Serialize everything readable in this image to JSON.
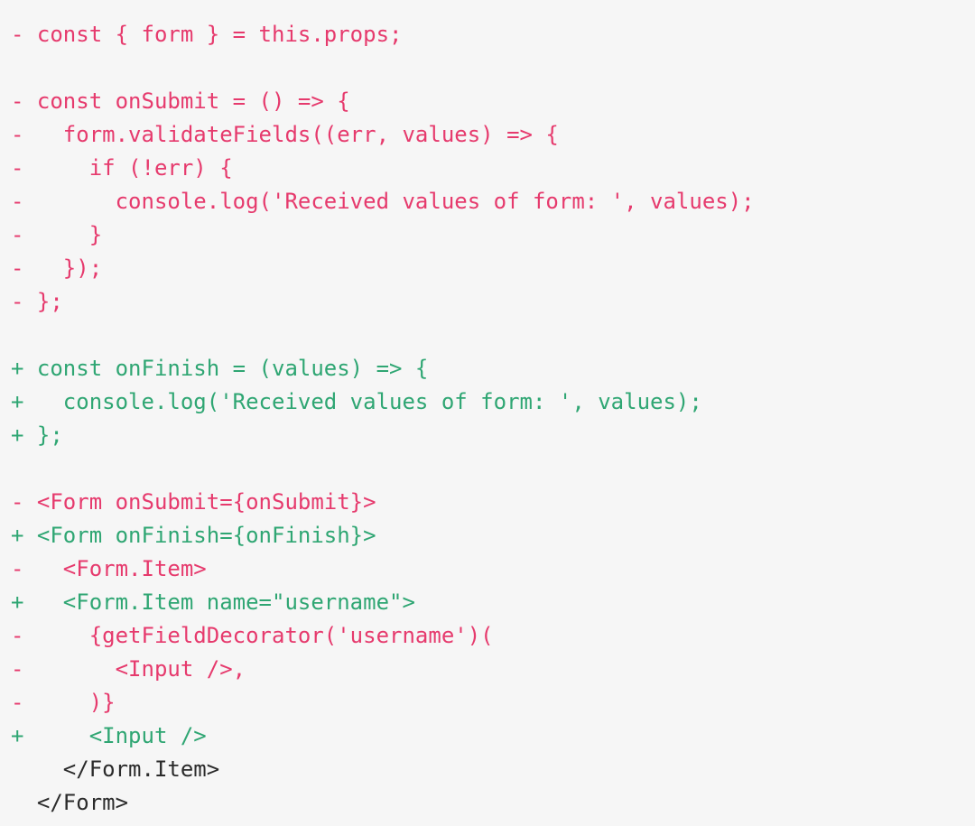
{
  "view": {
    "kind": "unified-code-diff",
    "language": "jsx",
    "background_color": "#f6f6f6",
    "colors": {
      "deletion": "#e63a6d",
      "addition": "#2fa673",
      "context": "#2b2b2b",
      "background": "#f6f6f6"
    }
  },
  "diff": {
    "lines": [
      {
        "type": "del",
        "marker": "-",
        "code": " const { form } = this.props;"
      },
      {
        "type": "blank",
        "marker": " ",
        "code": ""
      },
      {
        "type": "del",
        "marker": "-",
        "code": " const onSubmit = () => {"
      },
      {
        "type": "del",
        "marker": "-",
        "code": "   form.validateFields((err, values) => {"
      },
      {
        "type": "del",
        "marker": "-",
        "code": "     if (!err) {"
      },
      {
        "type": "del",
        "marker": "-",
        "code": "       console.log('Received values of form: ', values);"
      },
      {
        "type": "del",
        "marker": "-",
        "code": "     }"
      },
      {
        "type": "del",
        "marker": "-",
        "code": "   });"
      },
      {
        "type": "del",
        "marker": "-",
        "code": " };"
      },
      {
        "type": "blank",
        "marker": " ",
        "code": ""
      },
      {
        "type": "add",
        "marker": "+",
        "code": " const onFinish = (values) => {"
      },
      {
        "type": "add",
        "marker": "+",
        "code": "   console.log('Received values of form: ', values);"
      },
      {
        "type": "add",
        "marker": "+",
        "code": " };"
      },
      {
        "type": "blank",
        "marker": " ",
        "code": ""
      },
      {
        "type": "del",
        "marker": "-",
        "code": " <Form onSubmit={onSubmit}>"
      },
      {
        "type": "add",
        "marker": "+",
        "code": " <Form onFinish={onFinish}>"
      },
      {
        "type": "del",
        "marker": "-",
        "code": "   <Form.Item>"
      },
      {
        "type": "add",
        "marker": "+",
        "code": "   <Form.Item name=\"username\">"
      },
      {
        "type": "del",
        "marker": "-",
        "code": "     {getFieldDecorator('username')("
      },
      {
        "type": "del",
        "marker": "-",
        "code": "       <Input />,"
      },
      {
        "type": "del",
        "marker": "-",
        "code": "     )}"
      },
      {
        "type": "add",
        "marker": "+",
        "code": "     <Input />"
      },
      {
        "type": "ctx",
        "marker": " ",
        "code": "   </Form.Item>"
      },
      {
        "type": "ctx",
        "marker": " ",
        "code": " </Form>"
      }
    ]
  }
}
